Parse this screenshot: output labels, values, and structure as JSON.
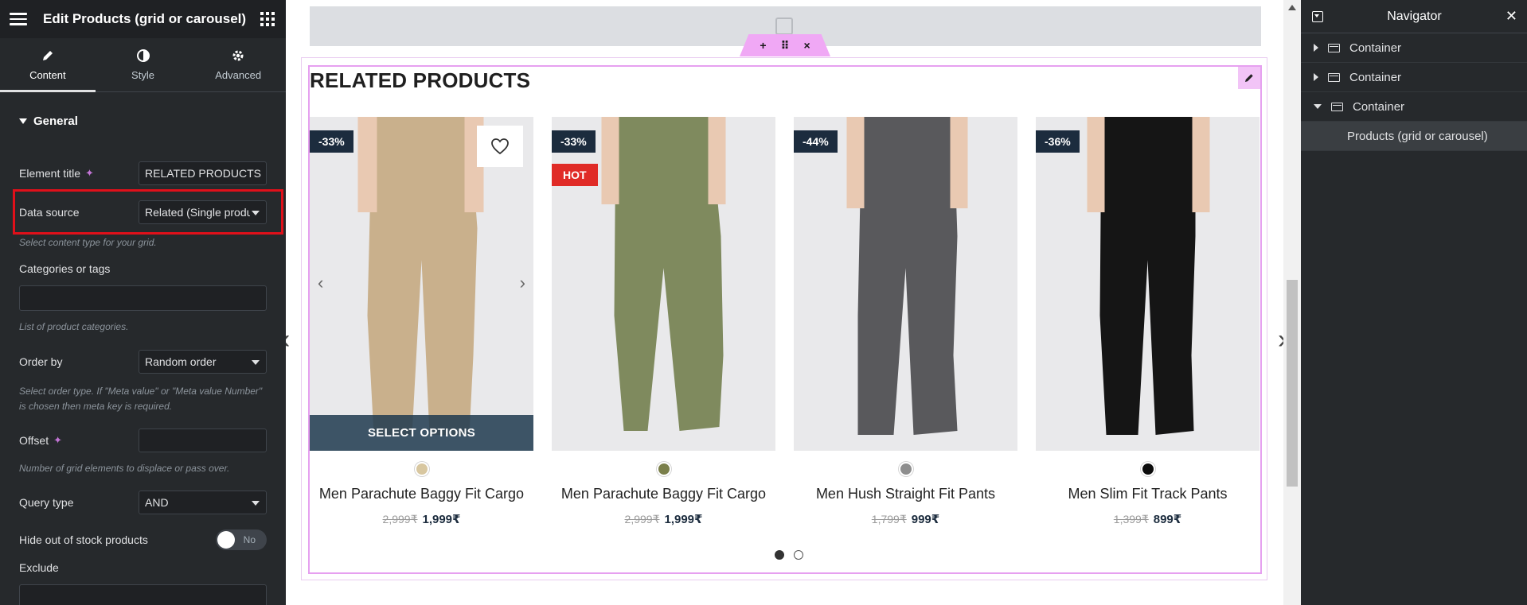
{
  "panel": {
    "title": "Edit Products (grid or carousel)",
    "tabs": [
      {
        "label": "Content",
        "icon": "pencil-icon",
        "active": true
      },
      {
        "label": "Style",
        "icon": "half-circle-icon",
        "active": false
      },
      {
        "label": "Advanced",
        "icon": "gear-icon",
        "active": false
      }
    ],
    "section": "General",
    "element_title_label": "Element title",
    "element_title_value": "RELATED PRODUCTS",
    "data_source_label": "Data source",
    "data_source_value": "Related (Single product)",
    "data_source_desc": "Select content type for your grid.",
    "categories_label": "Categories or tags",
    "categories_desc": "List of product categories.",
    "order_by_label": "Order by",
    "order_by_value": "Random order",
    "order_by_desc": "Select order type. If \"Meta value\" or \"Meta value Number\" is chosen then meta key is required.",
    "offset_label": "Offset",
    "offset_value": "",
    "offset_desc": "Number of grid elements to displace or pass over.",
    "query_type_label": "Query type",
    "query_type_value": "AND",
    "hide_stock_label": "Hide out of stock products",
    "hide_stock_value": "No",
    "exclude_label": "Exclude",
    "highlight_color": "#e0101a"
  },
  "canvas": {
    "section_title": "RELATED PRODUCTS",
    "handle": {
      "add": "+",
      "move": "⠿",
      "close": "×"
    },
    "products": [
      {
        "name": "Men Parachute Baggy Fit Cargo",
        "discount": "-33%",
        "hot": "",
        "old_price": "2,999₹",
        "new_price": "1,999₹",
        "swatch": "#d8c7a0",
        "pants_color": "#c9b08c",
        "select_label": "SELECT OPTIONS"
      },
      {
        "name": "Men Parachute Baggy Fit Cargo",
        "discount": "-33%",
        "hot": "HOT",
        "old_price": "2,999₹",
        "new_price": "1,999₹",
        "swatch": "#7a7f4a",
        "pants_color": "#7f8a5e",
        "select_label": ""
      },
      {
        "name": "Men Hush Straight Fit Pants",
        "discount": "-44%",
        "hot": "",
        "old_price": "1,799₹",
        "new_price": "999₹",
        "swatch": "#8e8e8e",
        "pants_color": "#59595c",
        "select_label": ""
      },
      {
        "name": "Men Slim Fit Track Pants",
        "discount": "-36%",
        "hot": "",
        "old_price": "1,399₹",
        "new_price": "899₹",
        "swatch": "#0b0b0b",
        "pants_color": "#151515",
        "select_label": ""
      }
    ],
    "carousel_page": 1,
    "carousel_pages": 2
  },
  "navigator": {
    "title": "Navigator",
    "items": [
      {
        "label": "Container",
        "expanded": false
      },
      {
        "label": "Container",
        "expanded": false
      },
      {
        "label": "Container",
        "expanded": true
      }
    ],
    "child": "Products (grid or carousel)"
  }
}
